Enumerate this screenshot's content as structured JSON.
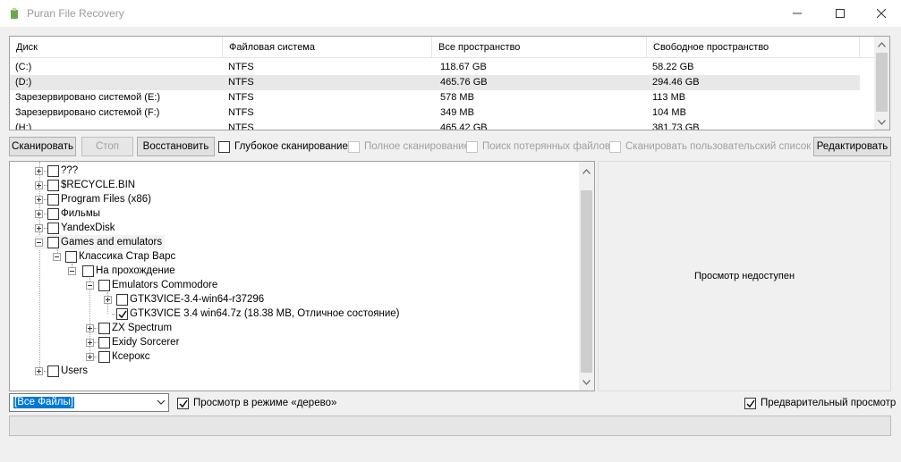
{
  "window": {
    "title": "Puran File Recovery",
    "minimize_glyph": "—",
    "maximize_glyph": "☐",
    "close_glyph": "✕"
  },
  "drive_list": {
    "columns": [
      "Диск",
      "Файловая система",
      "Все пространство",
      "Свободное пространство"
    ],
    "rows": [
      {
        "disk": " (C:)",
        "fs": "NTFS",
        "total": "118.67 GB",
        "free": "58.22 GB"
      },
      {
        "disk": " (D:)",
        "fs": "NTFS",
        "total": "465.76 GB",
        "free": "294.46 GB"
      },
      {
        "disk": "Зарезервировано системой (E:)",
        "fs": "NTFS",
        "total": "578 MB",
        "free": "113 MB"
      },
      {
        "disk": "Зарезервировано системой (F:)",
        "fs": "NTFS",
        "total": "349 MB",
        "free": "104 MB"
      },
      {
        "disk": " (H:)",
        "fs": "NTFS",
        "total": "465.42 GB",
        "free": "381.73 GB"
      }
    ]
  },
  "toolbar": {
    "scan": "Сканировать",
    "stop": "Стоп",
    "restore": "Восстановить",
    "deep_scan": "Глубокое сканирование",
    "full_scan": "Полное сканирование",
    "lost_files": "Поиск потерянных файлов",
    "custom_list": "Сканировать пользовательский список",
    "edit": "Редактировать"
  },
  "tree": {
    "items": [
      {
        "label": "???"
      },
      {
        "label": "$RECYCLE.BIN"
      },
      {
        "label": "Program Files (x86)"
      },
      {
        "label": "Фильмы"
      },
      {
        "label": "YandexDisk"
      },
      {
        "label": "Games and emulators"
      },
      {
        "label": "Классика Стар Варс"
      },
      {
        "label": "На прохождение"
      },
      {
        "label": "Emulators Commodore"
      },
      {
        "label": "GTK3VICE-3.4-win64-r37296"
      },
      {
        "label": "GTK3VICE 3.4 win64.7z  (18.38 MB, Отличное состояние)"
      },
      {
        "label": "ZX Spectrum"
      },
      {
        "label": "Exidy Sorcerer"
      },
      {
        "label": "Ксерокс"
      },
      {
        "label": "Users"
      }
    ]
  },
  "preview": {
    "message": "Просмотр недоступен"
  },
  "bottom": {
    "filter_value": "[Все Файлы]",
    "tree_view": "Просмотр в режиме «дерево»",
    "preview_toggle": "Предварительный просмотр"
  },
  "colors": {
    "selection": "#0078d7",
    "background": "#f0f0f0",
    "row_selected": "#e8e8e8"
  }
}
